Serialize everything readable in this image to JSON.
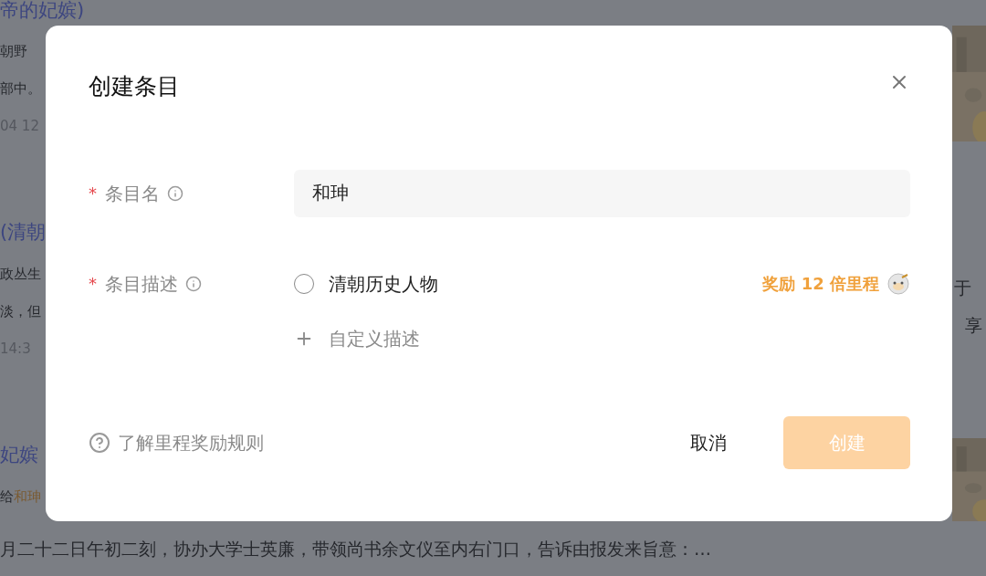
{
  "background": {
    "top_title": "帝的妃嫔)",
    "left_lines": [
      {
        "kind": "body",
        "text": "朝野"
      },
      {
        "kind": "body",
        "text": "部中。"
      },
      {
        "kind": "meta",
        "text": "04 12"
      },
      {
        "kind": "title",
        "text": "(清朝"
      },
      {
        "kind": "body",
        "text": "政丛生"
      },
      {
        "kind": "body",
        "text": "淡，但"
      },
      {
        "kind": "meta",
        "text": "14:3"
      },
      {
        "kind": "title",
        "text": "妃嫔"
      },
      {
        "kind": "mention",
        "text": "给",
        "highlight": "和珅"
      }
    ],
    "right_lines": [
      "于",
      "享"
    ],
    "bottom_line": "月二十二日午初二刻，协办大学士英廉，带领尚书余文仪至内右门口，告诉由报发来旨意：…"
  },
  "dialog": {
    "title": "创建条目",
    "fields": [
      {
        "kind": "text",
        "label": "条目名",
        "required_mark": "*",
        "value": "和珅"
      },
      {
        "kind": "options",
        "label": "条目描述",
        "required_mark": "*",
        "options": [
          {
            "text": "清朝历史人物",
            "selected": false
          }
        ],
        "reward": "奖励 12 倍里程",
        "add": "自定义描述"
      }
    ],
    "help": "了解里程奖励规则",
    "buttons": [
      {
        "kind": "text",
        "label": "取消",
        "disabled": false
      },
      {
        "kind": "primary",
        "label": "创建",
        "disabled": true
      }
    ]
  }
}
